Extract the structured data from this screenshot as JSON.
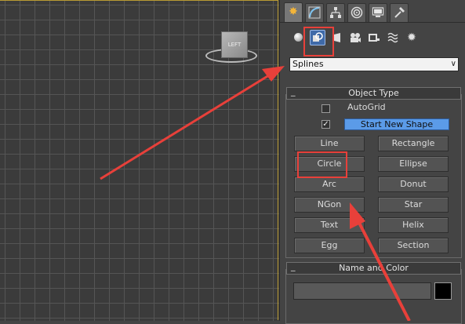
{
  "command_panel": {
    "tabs": [
      {
        "name": "create-tab",
        "icon": "sun-star-icon",
        "active": true
      },
      {
        "name": "modify-tab",
        "icon": "modify-curve-icon"
      },
      {
        "name": "hierarchy-tab",
        "icon": "hierarchy-icon"
      },
      {
        "name": "motion-tab",
        "icon": "motion-circle-icon"
      },
      {
        "name": "display-tab",
        "icon": "monitor-icon"
      },
      {
        "name": "utilities-tab",
        "icon": "hammer-icon"
      }
    ],
    "categories": [
      {
        "name": "geometry",
        "icon": "sphere-icon"
      },
      {
        "name": "shapes",
        "icon": "shapes-icon",
        "active": true
      },
      {
        "name": "lights",
        "icon": "light-icon"
      },
      {
        "name": "cameras",
        "icon": "camera-icon"
      },
      {
        "name": "helpers",
        "icon": "helper-tape-icon"
      },
      {
        "name": "space-warps",
        "icon": "wave-icon"
      },
      {
        "name": "systems",
        "icon": "gear-icon"
      }
    ],
    "dropdown": {
      "selected": "Splines"
    },
    "object_type": {
      "title": "Object Type",
      "autogrid_label": "AutoGrid",
      "autogrid_checked": false,
      "start_new_shape_checked": true,
      "start_new_shape_label": "Start New Shape",
      "buttons": [
        "Line",
        "Rectangle",
        "Circle",
        "Ellipse",
        "Arc",
        "Donut",
        "NGon",
        "Star",
        "Text",
        "Helix",
        "Egg",
        "Section"
      ]
    },
    "name_and_color": {
      "title": "Name and Color",
      "name_value": "",
      "color": "#000000"
    }
  },
  "viewport": {
    "viewcube_label": "LEFT"
  },
  "colors": {
    "highlight": "#e8403a",
    "accent_blue": "#5b9be8"
  }
}
